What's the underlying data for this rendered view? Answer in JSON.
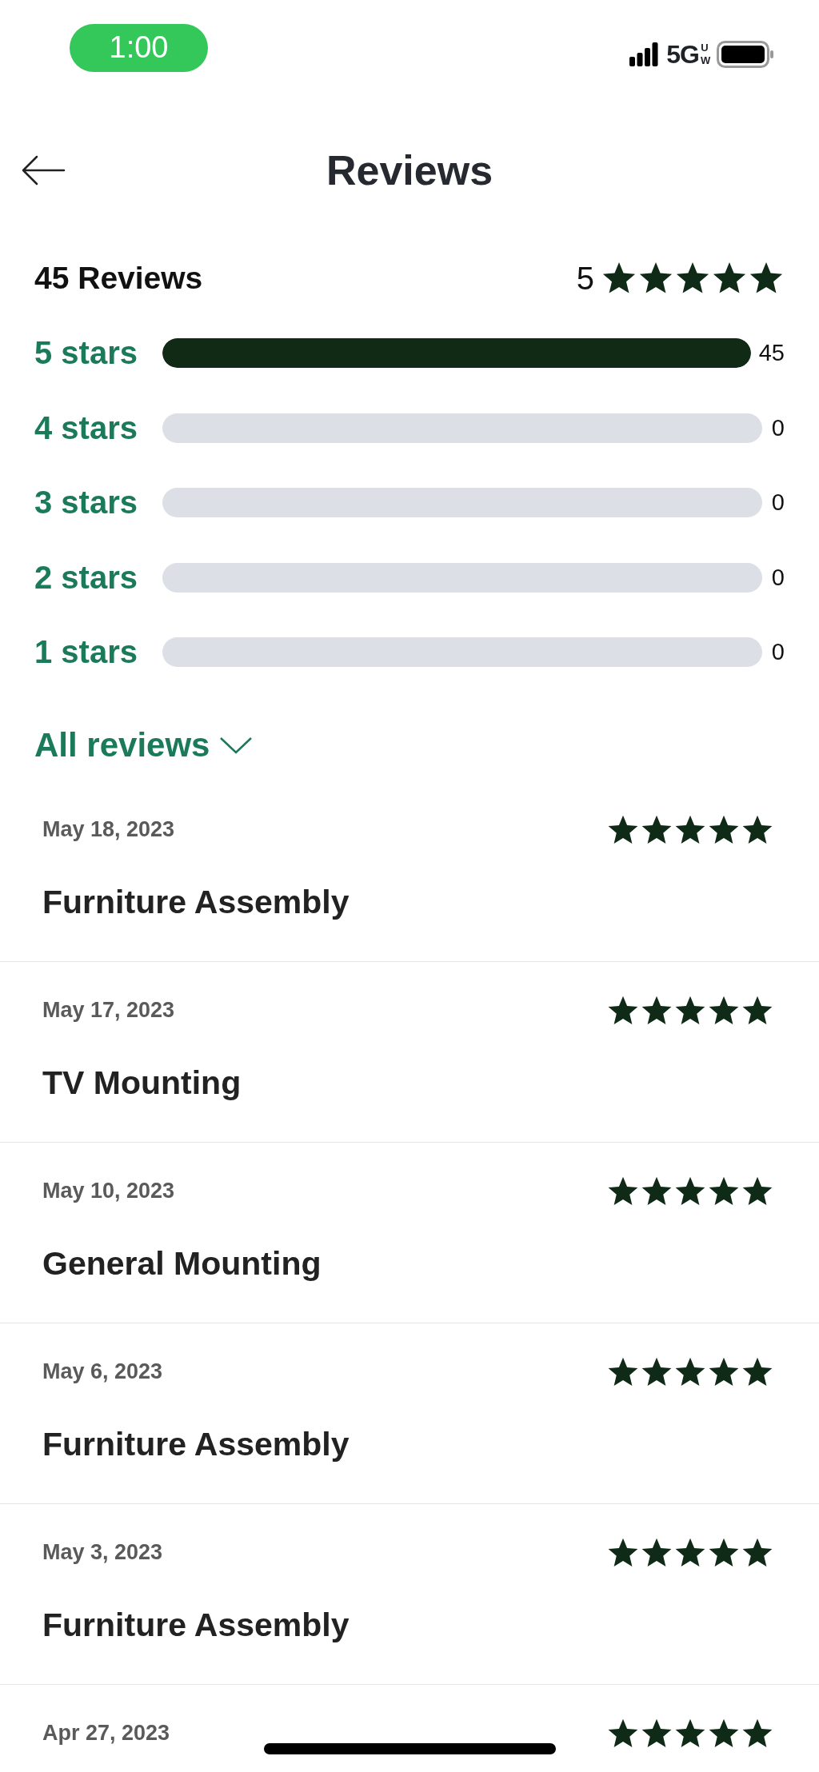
{
  "status_bar": {
    "time": "1:00",
    "network": "5G",
    "network_band": "UW"
  },
  "header": {
    "title": "Reviews"
  },
  "summary": {
    "count_label": "45 Reviews",
    "rating": "5",
    "stars": 5
  },
  "breakdown": [
    {
      "label": "5 stars",
      "level": 1,
      "count": "45"
    },
    {
      "label": "4 stars",
      "level": 0,
      "count": "0"
    },
    {
      "label": "3 stars",
      "level": 0,
      "count": "0"
    },
    {
      "label": "2 stars",
      "level": 0,
      "count": "0"
    },
    {
      "label": "1 stars",
      "level": 0,
      "count": "0"
    }
  ],
  "filter": {
    "label": "All reviews"
  },
  "reviews": [
    {
      "date": "May 18, 2023",
      "stars": 5,
      "title": "Furniture Assembly"
    },
    {
      "date": "May 17, 2023",
      "stars": 5,
      "title": "TV Mounting"
    },
    {
      "date": "May 10, 2023",
      "stars": 5,
      "title": "General Mounting"
    },
    {
      "date": "May 6, 2023",
      "stars": 5,
      "title": "Furniture Assembly"
    },
    {
      "date": "May 3, 2023",
      "stars": 5,
      "title": "Furniture Assembly"
    },
    {
      "date": "Apr 27, 2023",
      "stars": 5
    }
  ]
}
